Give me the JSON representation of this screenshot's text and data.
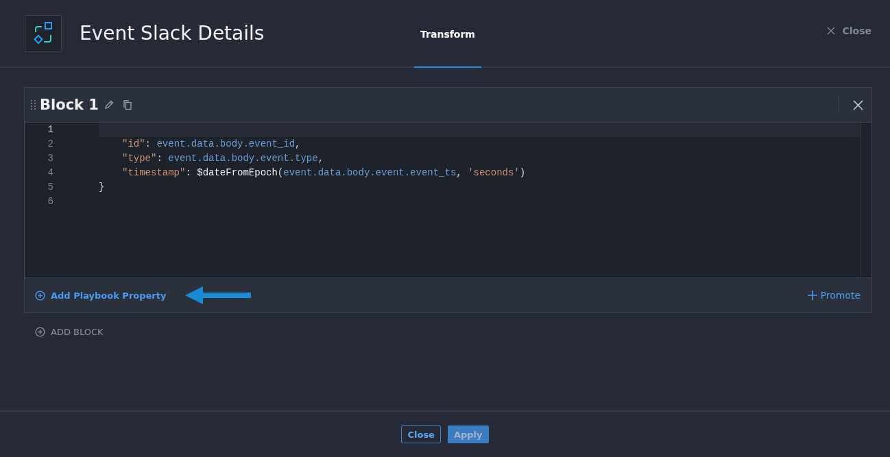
{
  "header": {
    "title": "Event Slack Details",
    "tabs": [
      {
        "label": "Transform",
        "selected": true
      }
    ],
    "close_label": "Close"
  },
  "blocks": [
    {
      "title": "Block 1",
      "lines": [
        {
          "number": "1",
          "active": true
        },
        {
          "number": "2",
          "active": false,
          "indented": true,
          "tokens": [
            {
              "kind": "key",
              "text": "\"id\""
            },
            {
              "kind": "plain",
              "text": ": "
            },
            {
              "kind": "ident",
              "text": "event.data.body.event_id"
            },
            {
              "kind": "plain",
              "text": ","
            }
          ]
        },
        {
          "number": "3",
          "active": false,
          "indented": true,
          "tokens": [
            {
              "kind": "key",
              "text": "\"type\""
            },
            {
              "kind": "plain",
              "text": ": "
            },
            {
              "kind": "ident",
              "text": "event.data.body.event.type"
            },
            {
              "kind": "plain",
              "text": ","
            }
          ]
        },
        {
          "number": "4",
          "active": false,
          "indented": true,
          "tokens": [
            {
              "kind": "key",
              "text": "\"timestamp\""
            },
            {
              "kind": "plain",
              "text": ": "
            },
            {
              "kind": "func",
              "text": "$dateFromEpoch"
            },
            {
              "kind": "plain",
              "text": "("
            },
            {
              "kind": "ident",
              "text": "event.data.body.event.event_ts"
            },
            {
              "kind": "plain",
              "text": ", "
            },
            {
              "kind": "string",
              "text": "'seconds'"
            },
            {
              "kind": "plain",
              "text": ")"
            }
          ]
        },
        {
          "number": "5",
          "active": false,
          "indented": false,
          "tokens": [
            {
              "kind": "plain",
              "text": "}"
            }
          ]
        },
        {
          "number": "6",
          "active": false
        }
      ],
      "add_property_label": "Add Playbook Property",
      "promote_label": "Promote"
    }
  ],
  "add_block_label": "ADD BLOCK",
  "footer": {
    "buttons": [
      {
        "label": "Close",
        "kind": "outline",
        "disabled": false
      },
      {
        "label": "Apply",
        "kind": "primary",
        "disabled": true
      }
    ]
  }
}
